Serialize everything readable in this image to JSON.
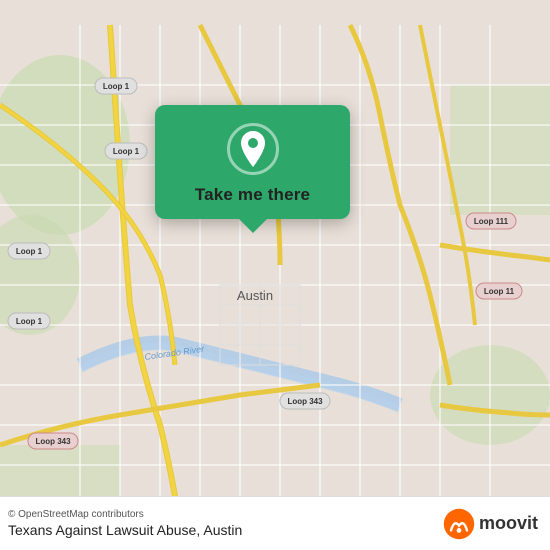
{
  "map": {
    "attribution": "© OpenStreetMap contributors",
    "place_name": "Texans Against Lawsuit Abuse, Austin",
    "background_color": "#e8e0d8"
  },
  "popup": {
    "label": "Take me there",
    "icon_name": "location-pin-icon"
  },
  "moovit": {
    "logo_text": "moovit",
    "icon_name": "moovit-logo-icon"
  },
  "roads": {
    "loop1_labels": [
      "Loop 1",
      "Loop 1",
      "Loop 1",
      "Loop 1"
    ],
    "loop111_label": "Loop 111",
    "loop343_labels": [
      "Loop 343",
      "Loop 343"
    ],
    "colorado_river_label": "Colorado River"
  }
}
